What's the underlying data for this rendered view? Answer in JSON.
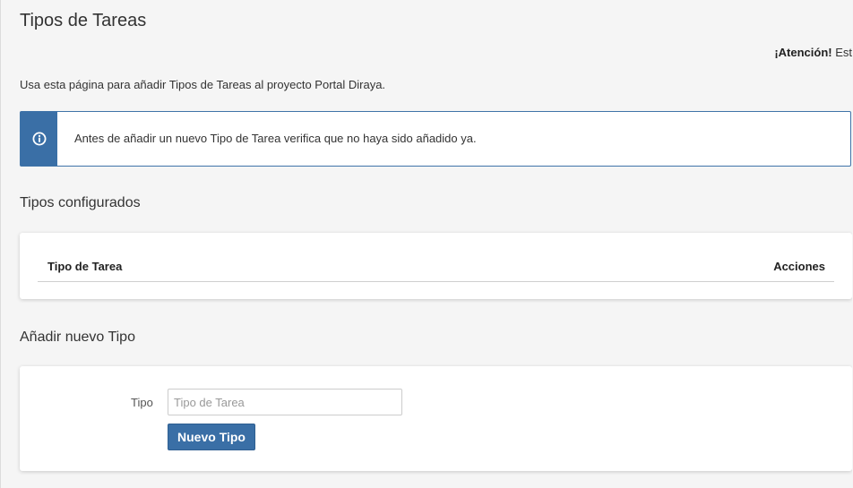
{
  "page": {
    "title": "Tipos de Tareas",
    "attention_bold": "¡Atención!",
    "attention_rest": " Est",
    "intro": "Usa esta página para añadir Tipos de Tareas al proyecto Portal Diraya."
  },
  "alert": {
    "icon": "info-circle-icon",
    "text": "Antes de añadir un nuevo Tipo de Tarea verifica que no haya sido añadido ya."
  },
  "configured": {
    "title": "Tipos configurados",
    "columns": [
      "Tipo de Tarea",
      "Acciones"
    ],
    "rows": []
  },
  "add_form": {
    "title": "Añadir nuevo Tipo",
    "label": "Tipo",
    "input_value": "",
    "input_placeholder": "Tipo de Tarea",
    "submit_label": "Nuevo Tipo"
  },
  "colors": {
    "accent": "#3a6fa6",
    "background": "#f5f5f5"
  }
}
